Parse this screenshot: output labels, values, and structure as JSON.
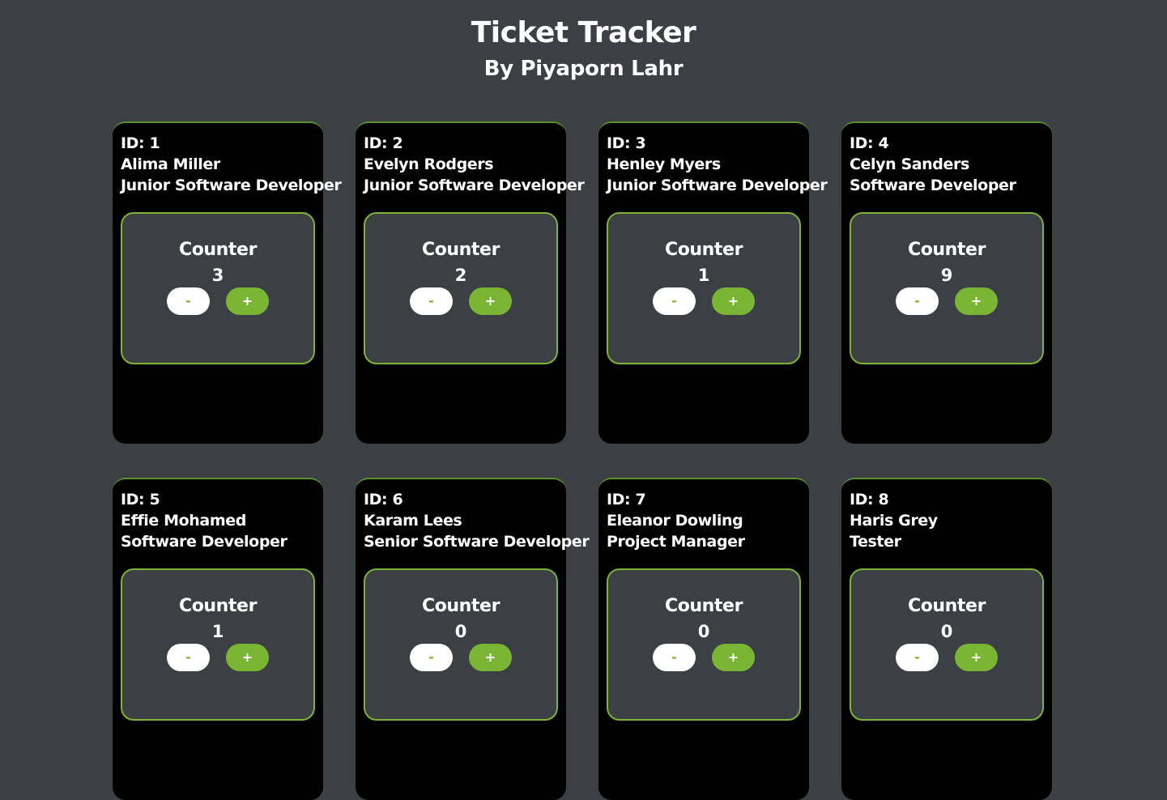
{
  "header": {
    "title": "Ticket Tracker",
    "subtitle": "By Piyaporn Lahr"
  },
  "colors": {
    "background": "#3c4045",
    "card": "#000000",
    "accent": "#7ab534",
    "text": "#ffffff"
  },
  "cards": [
    {
      "id": "ID: 1",
      "name": "Alima Miller",
      "role": "Junior Software Developer",
      "counter_label": "Counter",
      "count": "3",
      "minus_label": "-",
      "plus_label": "+"
    },
    {
      "id": "ID: 2",
      "name": "Evelyn Rodgers",
      "role": "Junior Software Developer",
      "counter_label": "Counter",
      "count": "2",
      "minus_label": "-",
      "plus_label": "+"
    },
    {
      "id": "ID: 3",
      "name": "Henley Myers",
      "role": "Junior Software Developer",
      "counter_label": "Counter",
      "count": "1",
      "minus_label": "-",
      "plus_label": "+"
    },
    {
      "id": "ID: 4",
      "name": "Celyn Sanders",
      "role": "Software Developer",
      "counter_label": "Counter",
      "count": "9",
      "minus_label": "-",
      "plus_label": "+"
    },
    {
      "id": "ID: 5",
      "name": "Effie Mohamed",
      "role": "Software Developer",
      "counter_label": "Counter",
      "count": "1",
      "minus_label": "-",
      "plus_label": "+"
    },
    {
      "id": "ID: 6",
      "name": "Karam Lees",
      "role": "Senior Software Developer",
      "counter_label": "Counter",
      "count": "0",
      "minus_label": "-",
      "plus_label": "+"
    },
    {
      "id": "ID: 7",
      "name": "Eleanor Dowling",
      "role": "Project Manager",
      "counter_label": "Counter",
      "count": "0",
      "minus_label": "-",
      "plus_label": "+"
    },
    {
      "id": "ID: 8",
      "name": "Haris Grey",
      "role": "Tester",
      "counter_label": "Counter",
      "count": "0",
      "minus_label": "-",
      "plus_label": "+"
    }
  ]
}
